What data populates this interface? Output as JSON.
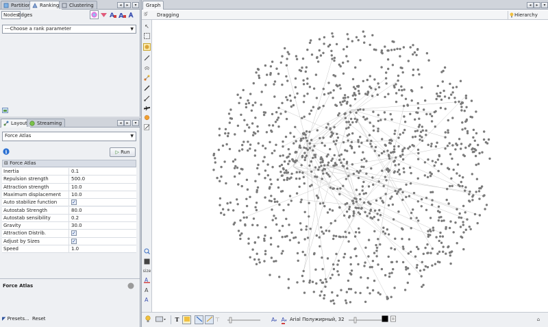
{
  "top_tabs": [
    {
      "label": "Partition",
      "active": false
    },
    {
      "label": "Ranking",
      "active": true
    },
    {
      "label": "Clustering",
      "active": false
    }
  ],
  "ranking": {
    "subtabs": [
      {
        "label": "Nodes",
        "active": true
      },
      {
        "label": "Edges",
        "active": false
      }
    ],
    "rank_param_placeholder": "---Choose a rank parameter",
    "icons": [
      "color-icon",
      "size-icon",
      "label-color-icon",
      "label-size-icon",
      "label-outline-icon"
    ]
  },
  "layout_tabs": [
    {
      "label": "Layout",
      "active": true
    },
    {
      "label": "Streaming",
      "active": false
    }
  ],
  "layout": {
    "selected_algorithm": "Force Atlas",
    "run_label": "Run",
    "properties_header": "Force Atlas",
    "properties": [
      {
        "name": "Inertia",
        "value": "0.1",
        "checkbox": false
      },
      {
        "name": "Repulsion strength",
        "value": "500.0",
        "checkbox": false
      },
      {
        "name": "Attraction strength",
        "value": "10.0",
        "checkbox": false
      },
      {
        "name": "Maximum displacement",
        "value": "10.0",
        "checkbox": false
      },
      {
        "name": "Auto stabilize function",
        "value": "",
        "checkbox": true,
        "checked": true
      },
      {
        "name": "Autostab Strength",
        "value": "80.0",
        "checkbox": false
      },
      {
        "name": "Autostab sensibility",
        "value": "0.2",
        "checkbox": false
      },
      {
        "name": "Gravity",
        "value": "30.0",
        "checkbox": false
      },
      {
        "name": "Attraction Distrib.",
        "value": "",
        "checkbox": true,
        "checked": true
      },
      {
        "name": "Adjust by Sizes",
        "value": "",
        "checkbox": true,
        "checked": true
      },
      {
        "name": "Speed",
        "value": "1.0",
        "checkbox": false
      }
    ],
    "description_title": "Force Atlas",
    "presets_label": "Presets...",
    "reset_label": "Reset"
  },
  "graph": {
    "tab_label": "Graph",
    "mode_label": "Dragging",
    "hierarchy_label": "Hierarchy",
    "left_size_label": "size",
    "font_label": "Arial Полужирный, 32",
    "accent_color": "#f0c040",
    "node_color": "#7a7a7a"
  }
}
